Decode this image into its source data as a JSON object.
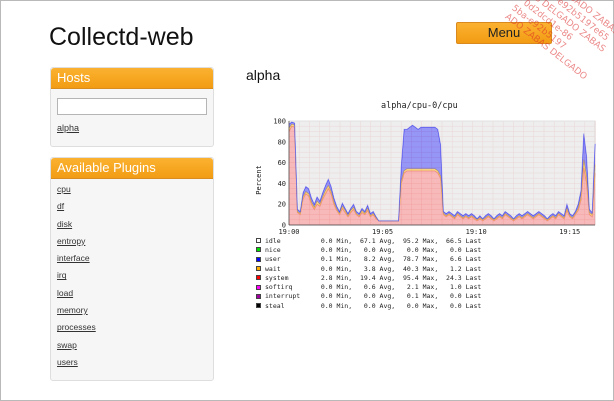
{
  "app": {
    "title": "Collectd-web",
    "menu_label": "Menu"
  },
  "sidebar": {
    "hosts_title": "Hosts",
    "hosts": [
      "alpha"
    ],
    "plugins_title": "Available Plugins",
    "plugins": [
      "cpu",
      "df",
      "disk",
      "entropy",
      "interface",
      "irq",
      "load",
      "memory",
      "processes",
      "swap",
      "users"
    ]
  },
  "main": {
    "host_title": "alpha",
    "graph_title": "alpha/cpu-0/cpu",
    "ylabel": "Percent",
    "side_label": "RRDTOOL / TOBI OETIKER"
  },
  "watermark": {
    "lines": [
      "SAS DELGADO ZABAS",
      "- a5ba-e92b5197e65",
      "SAS DELGADO ZABAS",
      "- 0d2dcd1e-86",
      "5ba-e92b5197",
      "ADO ZABAS DELGADO"
    ]
  },
  "chart_data": {
    "type": "area",
    "title": "alpha/cpu-0/cpu",
    "ylabel": "Percent",
    "ylim": [
      0,
      100
    ],
    "yticks": [
      "0",
      "20",
      "40",
      "60",
      "80",
      "100"
    ],
    "xticks": [
      "19:00",
      "19:05",
      "19:10",
      "19:15"
    ],
    "x": [
      0,
      3,
      6,
      9,
      12,
      15,
      18,
      21,
      24,
      27,
      30,
      33,
      36,
      39,
      42,
      45,
      48,
      51,
      54,
      57,
      60,
      63,
      66,
      69,
      72,
      75,
      78,
      81,
      84,
      87,
      90,
      93,
      96,
      99,
      102,
      105,
      108,
      111,
      114,
      117,
      120,
      123,
      126,
      129,
      132,
      135,
      138,
      141,
      144,
      147,
      150,
      153,
      156,
      159,
      162,
      165,
      168,
      171,
      174,
      177,
      180,
      183,
      186,
      189,
      192,
      195,
      198,
      201,
      204,
      207,
      210,
      213,
      216,
      219,
      222,
      225,
      228,
      231,
      234,
      237,
      240,
      243,
      246,
      249,
      252,
      255,
      258,
      261,
      264,
      267,
      270,
      273,
      276,
      279,
      282,
      285,
      288,
      291,
      294,
      297,
      300,
      303,
      306,
      309,
      312,
      315,
      318,
      321,
      324,
      327
    ],
    "x_unit": "seconds since 19:00",
    "grid": true,
    "series": [
      {
        "name": "system",
        "color": "#f08080",
        "values": [
          90,
          95,
          94,
          12,
          10,
          25,
          30,
          28,
          20,
          15,
          20,
          18,
          25,
          30,
          35,
          30,
          20,
          14,
          10,
          16,
          12,
          8,
          12,
          15,
          10,
          8,
          12,
          10,
          14,
          8,
          10,
          6,
          4,
          4,
          4,
          4,
          4,
          4,
          4,
          4,
          40,
          50,
          52,
          52,
          52,
          52,
          52,
          52,
          52,
          52,
          52,
          52,
          52,
          50,
          45,
          10,
          8,
          10,
          8,
          6,
          10,
          8,
          6,
          8,
          6,
          8,
          6,
          4,
          6,
          4,
          6,
          8,
          6,
          4,
          6,
          8,
          6,
          10,
          8,
          6,
          4,
          6,
          8,
          6,
          8,
          10,
          8,
          6,
          8,
          10,
          8,
          6,
          4,
          6,
          8,
          6,
          10,
          8,
          6,
          14,
          8,
          6,
          10,
          14,
          24,
          55,
          40,
          10,
          8,
          50
        ]
      },
      {
        "name": "wait",
        "color": "#f0c040",
        "values": [
          3,
          2,
          2,
          1,
          1,
          2,
          2,
          2,
          2,
          2,
          3,
          2,
          2,
          3,
          3,
          2,
          2,
          1,
          1,
          2,
          2,
          1,
          2,
          2,
          1,
          1,
          2,
          1,
          2,
          1,
          1,
          1,
          0,
          0,
          0,
          0,
          0,
          0,
          0,
          0,
          2,
          2,
          2,
          2,
          2,
          2,
          2,
          2,
          2,
          2,
          2,
          2,
          2,
          2,
          2,
          1,
          1,
          1,
          1,
          1,
          1,
          1,
          1,
          1,
          1,
          1,
          1,
          1,
          1,
          1,
          1,
          1,
          1,
          1,
          1,
          1,
          1,
          1,
          1,
          1,
          1,
          1,
          1,
          1,
          1,
          1,
          1,
          1,
          1,
          1,
          1,
          1,
          1,
          1,
          1,
          1,
          1,
          1,
          1,
          2,
          1,
          1,
          1,
          2,
          3,
          8,
          6,
          2,
          2,
          8
        ]
      },
      {
        "name": "user",
        "color": "#4040f0",
        "values": [
          4,
          2,
          2,
          2,
          2,
          4,
          5,
          5,
          4,
          3,
          4,
          3,
          4,
          5,
          6,
          5,
          4,
          3,
          2,
          3,
          2,
          2,
          2,
          3,
          2,
          2,
          2,
          2,
          3,
          2,
          2,
          1,
          0,
          0,
          0,
          0,
          0,
          0,
          0,
          0,
          15,
          40,
          38,
          40,
          42,
          40,
          38,
          40,
          40,
          40,
          40,
          40,
          40,
          40,
          30,
          2,
          2,
          2,
          2,
          2,
          2,
          2,
          2,
          2,
          2,
          2,
          2,
          1,
          2,
          1,
          2,
          2,
          2,
          1,
          2,
          2,
          2,
          2,
          2,
          2,
          1,
          2,
          2,
          2,
          2,
          2,
          2,
          2,
          2,
          2,
          2,
          2,
          1,
          2,
          2,
          2,
          2,
          2,
          2,
          4,
          2,
          2,
          2,
          4,
          6,
          25,
          20,
          3,
          2,
          20
        ]
      },
      {
        "name": "idle",
        "color": "#e0e0e0",
        "values": [
          3,
          1,
          2,
          85,
          87,
          69,
          63,
          65,
          74,
          80,
          73,
          77,
          69,
          62,
          56,
          63,
          74,
          82,
          87,
          79,
          84,
          89,
          84,
          80,
          87,
          89,
          84,
          87,
          81,
          89,
          87,
          92,
          96,
          96,
          96,
          96,
          96,
          96,
          96,
          96,
          43,
          8,
          8,
          6,
          4,
          6,
          8,
          6,
          6,
          6,
          6,
          6,
          6,
          8,
          23,
          87,
          89,
          87,
          89,
          91,
          87,
          89,
          91,
          89,
          91,
          89,
          91,
          94,
          91,
          94,
          91,
          89,
          91,
          94,
          91,
          89,
          91,
          87,
          89,
          91,
          94,
          91,
          89,
          91,
          89,
          87,
          89,
          91,
          89,
          87,
          89,
          91,
          94,
          91,
          89,
          91,
          87,
          89,
          91,
          80,
          89,
          91,
          87,
          80,
          67,
          12,
          34,
          85,
          88,
          22
        ]
      }
    ],
    "legend": [
      {
        "name": "idle",
        "color": "#ffffff",
        "min": "0.0 Min,",
        "avg": "67.1 Avg,",
        "max": "95.2 Max,",
        "last": "66.5 Last"
      },
      {
        "name": "nice",
        "color": "#00e000",
        "min": "0.0 Min,",
        "avg": "0.0 Avg,",
        "max": "0.0 Max,",
        "last": "0.0 Last"
      },
      {
        "name": "user",
        "color": "#0000ff",
        "min": "0.1 Min,",
        "avg": "8.2 Avg,",
        "max": "78.7 Max,",
        "last": "6.6 Last"
      },
      {
        "name": "wait",
        "color": "#ffb000",
        "min": "0.0 Min,",
        "avg": "3.8 Avg,",
        "max": "40.3 Max,",
        "last": "1.2 Last"
      },
      {
        "name": "system",
        "color": "#ff0000",
        "min": "2.8 Min,",
        "avg": "19.4 Avg,",
        "max": "95.4 Max,",
        "last": "24.3 Last"
      },
      {
        "name": "softirq",
        "color": "#ff00ff",
        "min": "0.0 Min,",
        "avg": "0.6 Avg,",
        "max": "2.1 Max,",
        "last": "1.0 Last"
      },
      {
        "name": "interrupt",
        "color": "#a000a0",
        "min": "0.0 Min,",
        "avg": "0.0 Avg,",
        "max": "0.1 Max,",
        "last": "0.0 Last"
      },
      {
        "name": "steal",
        "color": "#000000",
        "min": "0.0 Min,",
        "avg": "0.0 Avg,",
        "max": "0.0 Max,",
        "last": "0.0 Last"
      }
    ]
  }
}
